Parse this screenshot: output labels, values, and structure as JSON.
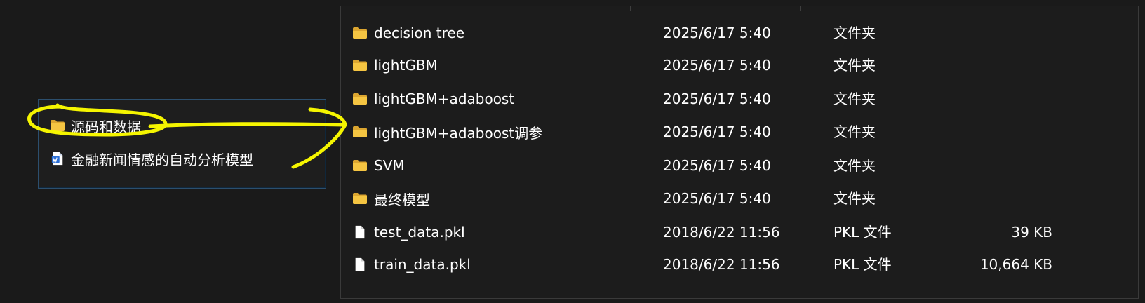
{
  "colors": {
    "folder": "#f5c542",
    "folder_dark": "#dca630",
    "highlight": "#f5f500",
    "panel_border": "#2c4f6e",
    "text": "#ffffff"
  },
  "left_panel": {
    "items": [
      {
        "icon": "folder-icon",
        "label": "源码和数据"
      },
      {
        "icon": "word-document-icon",
        "label": "金融新闻情感的自动分析模型"
      }
    ]
  },
  "file_list": {
    "rows": [
      {
        "icon": "folder-icon",
        "name": "decision tree",
        "date": "2025/6/17 5:40",
        "type": "文件夹",
        "size": ""
      },
      {
        "icon": "folder-icon",
        "name": "lightGBM",
        "date": "2025/6/17 5:40",
        "type": "文件夹",
        "size": ""
      },
      {
        "icon": "folder-icon",
        "name": "lightGBM+adaboost",
        "date": "2025/6/17 5:40",
        "type": "文件夹",
        "size": ""
      },
      {
        "icon": "folder-icon",
        "name": "lightGBM+adaboost调参",
        "date": "2025/6/17 5:40",
        "type": "文件夹",
        "size": ""
      },
      {
        "icon": "folder-icon",
        "name": "SVM",
        "date": "2025/6/17 5:40",
        "type": "文件夹",
        "size": ""
      },
      {
        "icon": "folder-icon",
        "name": "最终模型",
        "date": "2025/6/17 5:40",
        "type": "文件夹",
        "size": ""
      },
      {
        "icon": "file-icon",
        "name": "test_data.pkl",
        "date": "2018/6/22 11:56",
        "type": "PKL 文件",
        "size": "39 KB"
      },
      {
        "icon": "file-icon",
        "name": "train_data.pkl",
        "date": "2018/6/22 11:56",
        "type": "PKL 文件",
        "size": "10,664 KB"
      }
    ]
  }
}
